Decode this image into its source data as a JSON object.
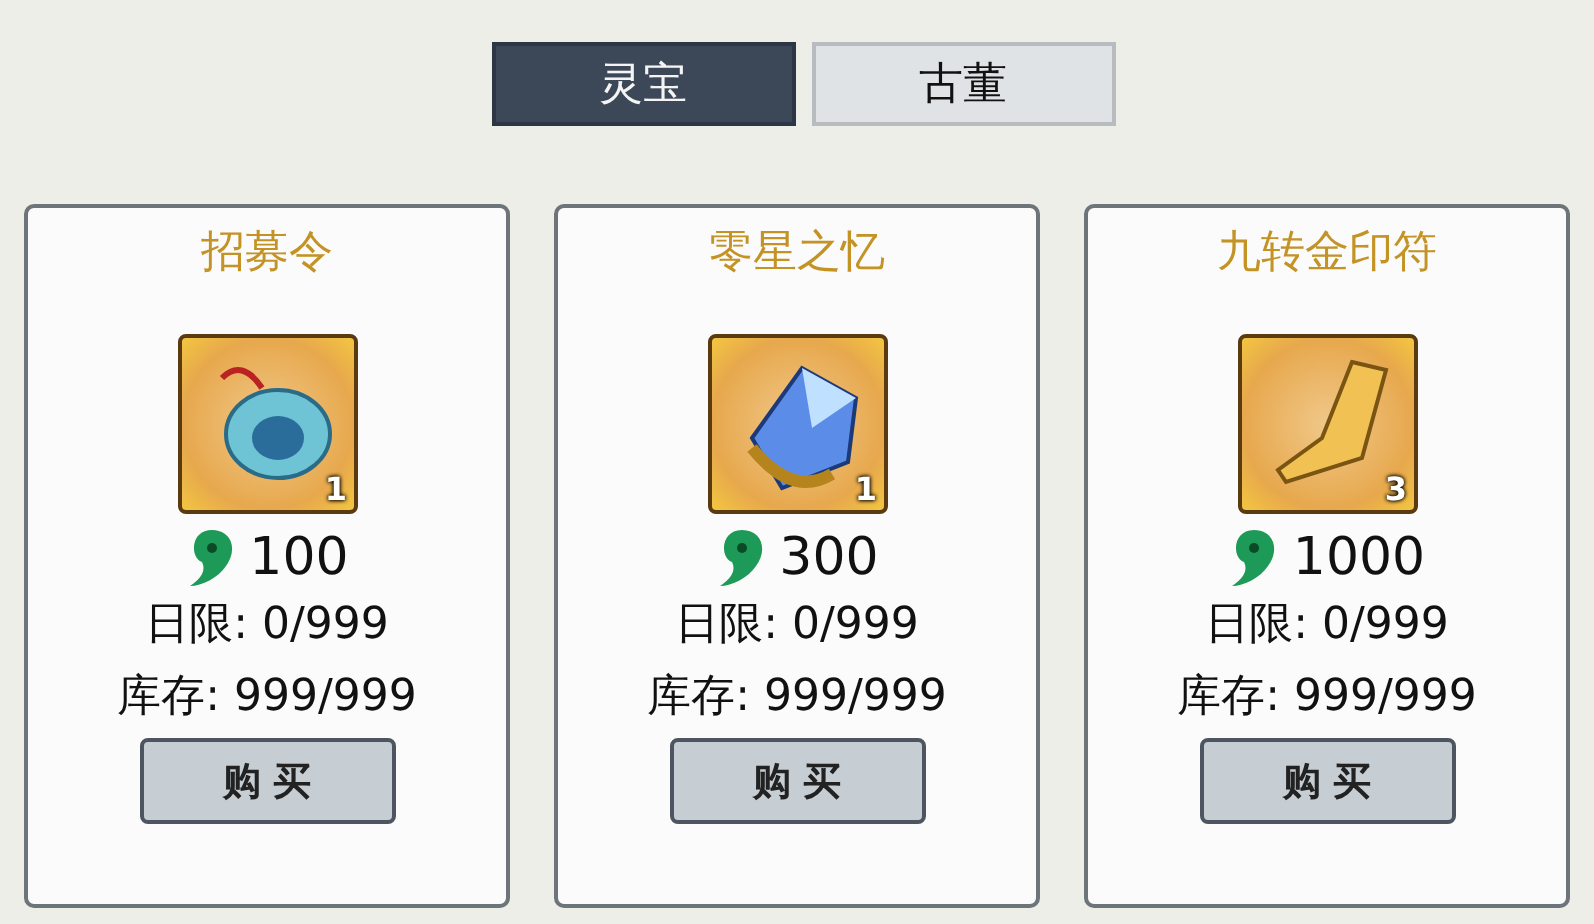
{
  "tabs": [
    {
      "label": "灵宝",
      "selected": true
    },
    {
      "label": "古董",
      "selected": false
    }
  ],
  "items": [
    {
      "name": "招募令",
      "kind": "token",
      "count": "1",
      "price": "100",
      "daily_limit": "日限: 0/999",
      "stock": "库存: 999/999",
      "button": "购买"
    },
    {
      "name": "零星之忆",
      "kind": "crystal",
      "count": "1",
      "price": "300",
      "daily_limit": "日限: 0/999",
      "stock": "库存: 999/999",
      "button": "购买"
    },
    {
      "name": "九转金印符",
      "kind": "scroll",
      "count": "3",
      "price": "1000",
      "daily_limit": "日限: 0/999",
      "stock": "库存: 999/999",
      "button": "购买"
    }
  ]
}
